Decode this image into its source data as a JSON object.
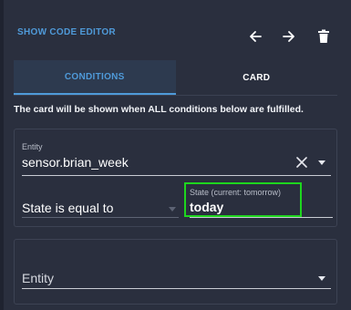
{
  "header": {
    "show_code_editor_label": "SHOW CODE EDITOR"
  },
  "toolbar": {
    "back_icon": "arrow-left-icon",
    "forward_icon": "arrow-right-icon",
    "delete_icon": "trash-icon"
  },
  "tabs": [
    {
      "label": "CONDITIONS",
      "active": true
    },
    {
      "label": "CARD",
      "active": false
    }
  ],
  "info_text": "The card will be shown when ALL conditions below are fulfilled.",
  "condition1": {
    "entity_label": "Entity",
    "entity_value": "sensor.brian_week",
    "state_operator": "State is equal to",
    "state_label": "State (current: tomorrow)",
    "state_value": "today"
  },
  "condition2": {
    "entity_placeholder": "Entity"
  },
  "colors": {
    "background": "#2a2f3e",
    "accent": "#4f9ad9",
    "highlight": "#1ed61e"
  }
}
